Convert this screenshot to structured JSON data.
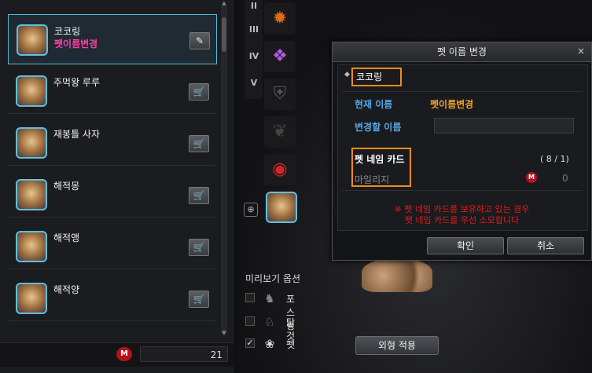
{
  "pet_list": {
    "items": [
      {
        "name": "코코링",
        "sub": "펫이름변경",
        "action_icon": "edit-icon",
        "action_glyph": "✎"
      },
      {
        "name": "주먹왕 루루",
        "action_icon": "cart-icon",
        "action_glyph": "🛒"
      },
      {
        "name": "재봉틀 사자",
        "action_icon": "cart-icon",
        "action_glyph": "🛒"
      },
      {
        "name": "해적몽",
        "action_icon": "cart-icon",
        "action_glyph": "🛒"
      },
      {
        "name": "해적앵",
        "action_icon": "cart-icon",
        "action_glyph": "🛒"
      },
      {
        "name": "해적양",
        "action_icon": "cart-icon",
        "action_glyph": "🛒"
      }
    ],
    "footer_mileage": "21",
    "mileage_icon_text": "M"
  },
  "tiers": [
    "II",
    "III",
    "IV",
    "V"
  ],
  "preview_options": {
    "title": "미리보기 옵션",
    "options": [
      {
        "label": "포스링",
        "checked": false,
        "icon": "figure-icon"
      },
      {
        "label": "탈것",
        "checked": false,
        "icon": "mount-icon"
      },
      {
        "label": "펫",
        "checked": true,
        "icon": "paw-icon"
      }
    ],
    "apply_label": "외형 적용"
  },
  "dialog": {
    "title": "펫 이름 변경",
    "close": "×",
    "pet_name": "코코링",
    "current_name_label": "현재 이름",
    "current_name_value": "펫이름변경",
    "new_name_label": "변경할 이름",
    "new_name_value": "",
    "card_label": "펫 네임 카드",
    "card_count": "( 8 / 1)",
    "mileage_label": "마일리지",
    "mileage_value": "0",
    "notice_line1": "※ 펫 네임 카드를 보유하고 있는 경우",
    "notice_line2": "펫 네임 카드를 우선 소모합니다",
    "confirm_label": "확인",
    "cancel_label": "취소"
  },
  "colors": {
    "selected_border": "#58b7d6",
    "highlight_orange": "#f28a1e",
    "label_blue": "#57a7e8",
    "value_gold": "#f2a22a",
    "notice_red": "#e51a1a",
    "sub_pink": "#ff3fa6"
  }
}
